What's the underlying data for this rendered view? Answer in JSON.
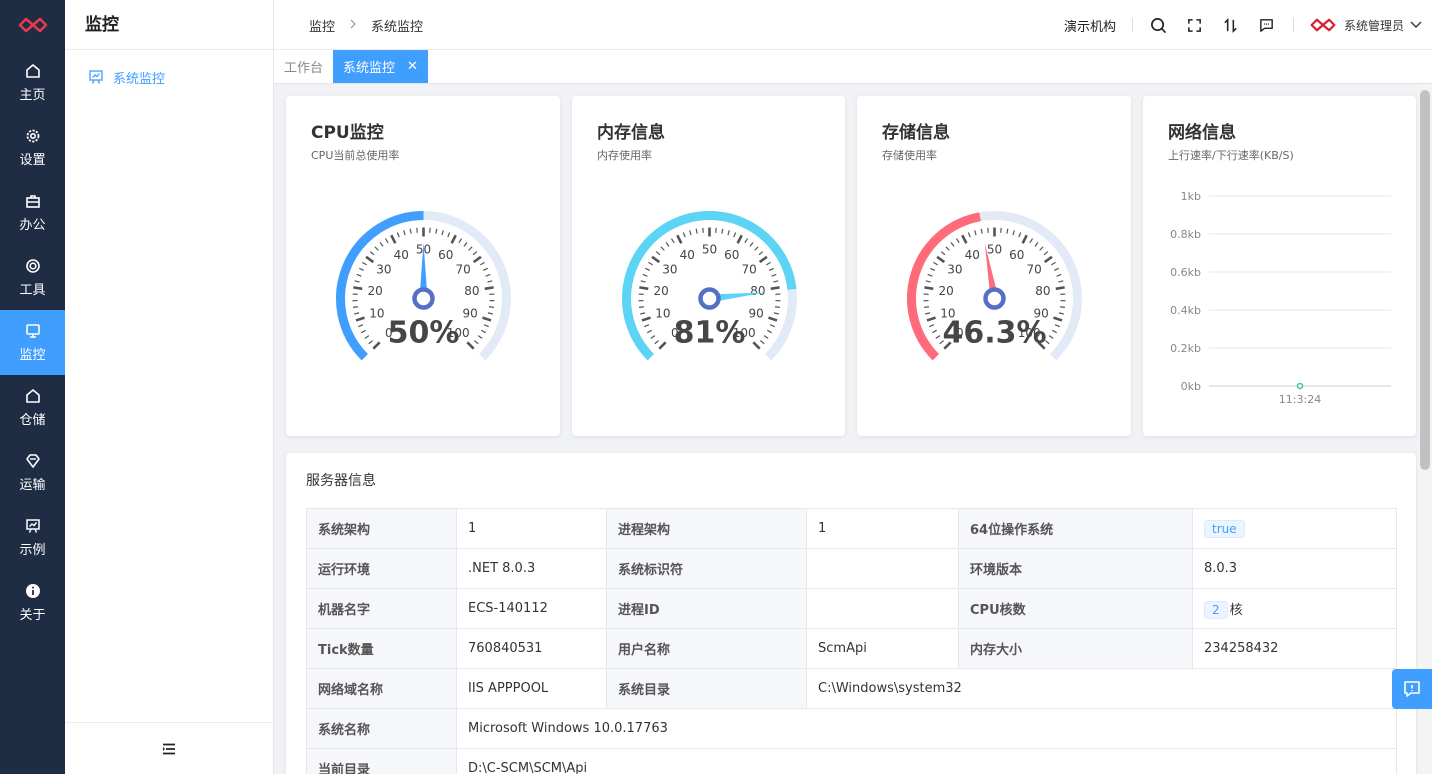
{
  "nav": {
    "items": [
      {
        "label": "主页",
        "icon": "home-icon"
      },
      {
        "label": "设置",
        "icon": "gear-icon"
      },
      {
        "label": "办公",
        "icon": "briefcase-icon"
      },
      {
        "label": "工具",
        "icon": "lifebuoy-icon"
      },
      {
        "label": "监控",
        "icon": "monitor-icon"
      },
      {
        "label": "仓储",
        "icon": "warehouse-icon"
      },
      {
        "label": "运输",
        "icon": "diamond-icon"
      },
      {
        "label": "示例",
        "icon": "presentation-icon"
      },
      {
        "label": "关于",
        "icon": "info-icon"
      }
    ],
    "active_index": 4
  },
  "subside": {
    "title": "监控",
    "items": [
      {
        "label": "系统监控",
        "icon": "presentation-icon"
      }
    ]
  },
  "header": {
    "breadcrumb": [
      "监控",
      "系统监控"
    ],
    "org": "演示机构",
    "username": "系统管理员"
  },
  "tabs": [
    {
      "label": "工作台",
      "active": false
    },
    {
      "label": "系统监控",
      "active": true
    }
  ],
  "gauges": [
    {
      "title": "CPU监控",
      "subtitle": "CPU当前总使用率",
      "value": 50,
      "display": "50%",
      "color": "#409eff"
    },
    {
      "title": "内存信息",
      "subtitle": "内存使用率",
      "value": 81,
      "display": "81%",
      "color": "#5bd4f5"
    },
    {
      "title": "存储信息",
      "subtitle": "存储使用率",
      "value": 46.3,
      "display": "46.3%",
      "color": "#ff6b7a"
    }
  ],
  "gauge_ticks": [
    "0",
    "10",
    "20",
    "30",
    "40",
    "50",
    "60",
    "70",
    "80",
    "90",
    "100"
  ],
  "network": {
    "title": "网络信息",
    "subtitle": "上行速率/下行速率(KB/S)",
    "chart_data": {
      "type": "line",
      "categories": [
        "11:3:24"
      ],
      "series": [
        {
          "values": [
            0
          ]
        }
      ],
      "ylim": [
        0,
        1
      ],
      "y_ticks": [
        "0kb",
        "0.2kb",
        "0.4kb",
        "0.6kb",
        "0.8kb",
        "1kb"
      ],
      "grid": true
    }
  },
  "server": {
    "title": "服务器信息",
    "rows": [
      [
        {
          "l": "系统架构"
        },
        {
          "v": "1"
        },
        {
          "l": "进程架构"
        },
        {
          "v": "1"
        },
        {
          "l": "64位操作系统"
        },
        {
          "tag": "true"
        }
      ],
      [
        {
          "l": "运行环境"
        },
        {
          "v": ".NET 8.0.3"
        },
        {
          "l": "系统标识符"
        },
        {
          "v": ""
        },
        {
          "l": "环境版本"
        },
        {
          "v": "8.0.3"
        }
      ],
      [
        {
          "l": "机器名字"
        },
        {
          "v": "ECS-140112"
        },
        {
          "l": "进程ID"
        },
        {
          "v": ""
        },
        {
          "l": "CPU核数"
        },
        {
          "tag": "2",
          "suffix": "核"
        }
      ],
      [
        {
          "l": "Tick数量"
        },
        {
          "v": "760840531"
        },
        {
          "l": "用户名称"
        },
        {
          "v": "ScmApi"
        },
        {
          "l": "内存大小"
        },
        {
          "v": "234258432"
        }
      ],
      [
        {
          "l": "网络域名称"
        },
        {
          "v": "IIS APPPOOL"
        },
        {
          "l": "系统目录"
        },
        {
          "v": "C:\\Windows\\system32",
          "span": 3
        }
      ],
      [
        {
          "l": "系统名称"
        },
        {
          "v": "Microsoft Windows 10.0.17763",
          "span": 5
        }
      ],
      [
        {
          "l": "当前目录"
        },
        {
          "v": "D:\\C-SCM\\SCM\\Api",
          "span": 5
        }
      ]
    ]
  }
}
